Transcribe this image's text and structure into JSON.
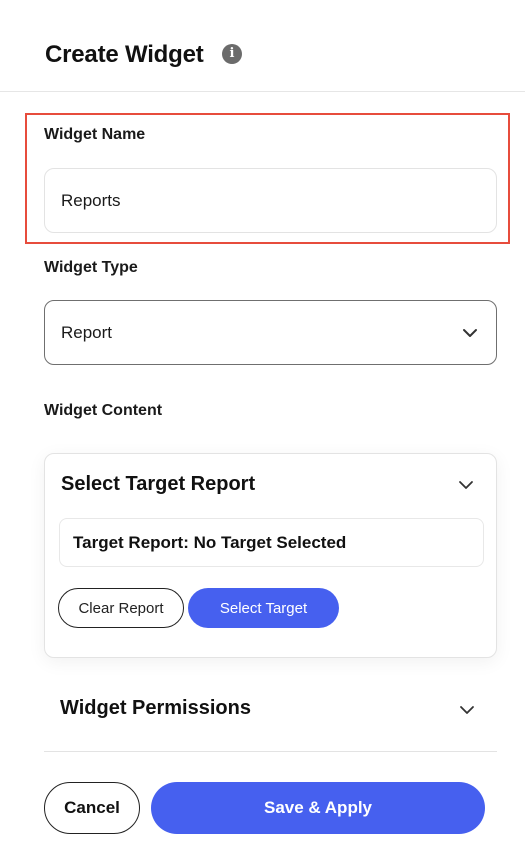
{
  "header": {
    "title": "Create Widget",
    "info_icon": "info-icon",
    "info_glyph": "i"
  },
  "form": {
    "widget_name": {
      "label": "Widget Name",
      "value": "Reports"
    },
    "widget_type": {
      "label": "Widget Type",
      "value": "Report"
    },
    "widget_content": {
      "label": "Widget Content",
      "section_title": "Select Target Report",
      "target_text": "Target Report: No Target Selected",
      "clear_button": "Clear Report",
      "select_button": "Select Target"
    },
    "permissions": {
      "title": "Widget Permissions"
    }
  },
  "footer": {
    "cancel_label": "Cancel",
    "save_label": "Save & Apply"
  },
  "colors": {
    "primary": "#4660ef",
    "highlight": "#e74c3c"
  }
}
